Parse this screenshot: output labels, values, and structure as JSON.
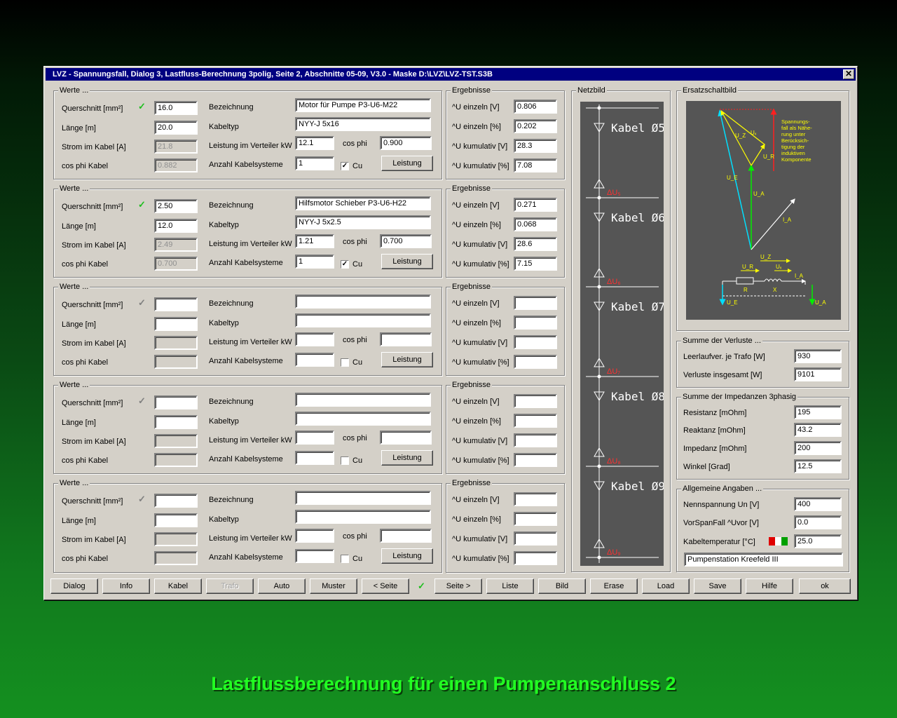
{
  "window": {
    "title": "LVZ - Spannungsfall, Dialog 3, Lastfluss-Berechnung 3polig, Seite 2, Abschnitte 05-09, V3.0 -  Maske D:\\LVZ\\LVZ-TST.S3B",
    "close_glyph": "✕"
  },
  "labels": {
    "werte": "Werte ...",
    "querschnitt": "Querschnitt [mm²]",
    "laenge": "Länge [m]",
    "strom": "Strom im Kabel [A]",
    "cosphi_kabel": "cos phi Kabel",
    "bezeichnung": "Bezeichnung",
    "kabeltyp": "Kabeltyp",
    "leistung_verteiler": "Leistung im Verteiler kW",
    "cos_phi": "cos phi",
    "anzahl": "Anzahl Kabelsysteme",
    "cu": "Cu",
    "leistung_btn": "Leistung",
    "ergebnisse": "Ergebnisse",
    "u_einzeln_v": "^U einzeln [V]",
    "u_einzeln_p": "^U einzeln [%]",
    "u_kum_v": "^U kumulativ [V]",
    "u_kum_p": "^U kumulativ [%]",
    "tick": "✓",
    "check": "✓"
  },
  "sections": [
    {
      "querschnitt": "16.0",
      "laenge": "20.0",
      "strom": "21.8",
      "cosphi_kabel": "0.882",
      "bezeichnung": "Motor für Pumpe P3-U6-M22",
      "kabeltyp": "NYY-J 5x16",
      "leistung": "12.1",
      "cosphi": "0.900",
      "anzahl": "1",
      "cu": true,
      "active": true,
      "u_einzeln_v": "0.806",
      "u_einzeln_p": "0.202",
      "u_kum_v": "28.3",
      "u_kum_p": "7.08"
    },
    {
      "querschnitt": "2.50",
      "laenge": "12.0",
      "strom": "2.49",
      "cosphi_kabel": "0.700",
      "bezeichnung": "Hilfsmotor Schieber P3-U6-H22",
      "kabeltyp": "NYY-J 5x2.5",
      "leistung": "1.21",
      "cosphi": "0.700",
      "anzahl": "1",
      "cu": true,
      "active": true,
      "u_einzeln_v": "0.271",
      "u_einzeln_p": "0.068",
      "u_kum_v": "28.6",
      "u_kum_p": "7.15"
    },
    {
      "querschnitt": "",
      "laenge": "",
      "strom": "",
      "cosphi_kabel": "",
      "bezeichnung": "",
      "kabeltyp": "",
      "leistung": "",
      "cosphi": "",
      "anzahl": "",
      "cu": false,
      "active": false,
      "u_einzeln_v": "",
      "u_einzeln_p": "",
      "u_kum_v": "",
      "u_kum_p": ""
    },
    {
      "querschnitt": "",
      "laenge": "",
      "strom": "",
      "cosphi_kabel": "",
      "bezeichnung": "",
      "kabeltyp": "",
      "leistung": "",
      "cosphi": "",
      "anzahl": "",
      "cu": false,
      "active": false,
      "u_einzeln_v": "",
      "u_einzeln_p": "",
      "u_kum_v": "",
      "u_kum_p": ""
    },
    {
      "querschnitt": "",
      "laenge": "",
      "strom": "",
      "cosphi_kabel": "",
      "bezeichnung": "",
      "kabeltyp": "",
      "leistung": "",
      "cosphi": "",
      "anzahl": "",
      "cu": false,
      "active": false,
      "u_einzeln_v": "",
      "u_einzeln_p": "",
      "u_kum_v": "",
      "u_kum_p": ""
    }
  ],
  "netzbild": {
    "title": "Netzbild",
    "kabel": [
      "Kabel Ø5",
      "Kabel Ø6",
      "Kabel Ø7",
      "Kabel Ø8",
      "Kabel Ø9"
    ],
    "du": [
      "ΔU₅",
      "ΔU₆",
      "ΔU₇",
      "ΔU₈",
      "ΔU₉"
    ]
  },
  "ersatz": {
    "title": "Ersatzschaltbild",
    "note": [
      "Spannungs-",
      "fall als Nähe-",
      "rung unter",
      "Berücksich-",
      "tigung der",
      "induktiven",
      "Komponente"
    ],
    "labels": {
      "ux": "Uₓ",
      "uz": "U_Z",
      "ur": "U_R",
      "ue": "U_E",
      "ua": "U_A",
      "ia": "I_A",
      "r": "R",
      "x": "X"
    }
  },
  "verluste": {
    "title": "Summe der Verluste ...",
    "leerlauf_label": "Leerlaufver. je Trafo [W]",
    "leerlauf": "930",
    "gesamt_label": "Verluste insgesamt [W]",
    "gesamt": "9101"
  },
  "impedanzen": {
    "title": "Summe der Impedanzen 3phasig",
    "resistanz_label": "Resistanz [mOhm]",
    "resistanz": "195",
    "reaktanz_label": "Reaktanz  [mOhm]",
    "reaktanz": "43.2",
    "impedanz_label": "Impedanz  [mOhm]",
    "impedanz": "200",
    "winkel_label": "Winkel    [Grad]",
    "winkel": "12.5"
  },
  "allgemein": {
    "title": "Allgemeine Angaben ...",
    "nenn_label": "Nennspannung Un [V]",
    "nenn": "400",
    "vorspan_label": "VorSpanFall ^Uvor [V]",
    "vorspan": "0.0",
    "temp_label": "Kabeltemperatur [°C]",
    "temp": "25.0",
    "station": "Pumpenstation Kreefeld III",
    "flag_colors": [
      "#e00000",
      "#ffffff",
      "#00a000"
    ]
  },
  "toolbar": [
    "Dialog",
    "Info",
    "Kabel",
    "Trafo",
    "Auto",
    "Muster",
    "< Seite",
    "Seite >",
    "Liste",
    "Bild",
    "Erase",
    "Load",
    "Save",
    "Hilfe",
    "ok"
  ],
  "toolbar_tick": "✓",
  "caption": "Lastflussberechnung für einen Pumpenanschluss 2"
}
